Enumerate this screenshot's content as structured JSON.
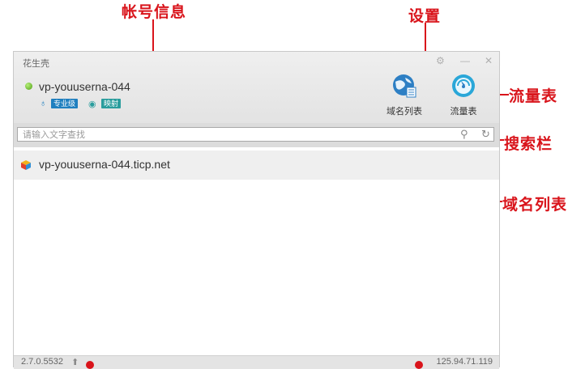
{
  "annotations": {
    "account_info": "帐号信息",
    "settings": "设置",
    "traffic_meter": "流量表",
    "search_bar": "搜索栏",
    "domain_list": "域名列表"
  },
  "window": {
    "title": "花生壳",
    "account": {
      "status": "online",
      "name": "vp-youuserna-044",
      "badges": [
        "专业级",
        "映射"
      ]
    },
    "toolbar": {
      "domain_list_label": "域名列表",
      "traffic_label": "流量表"
    },
    "search": {
      "placeholder": "请输入文字查找"
    },
    "domains": [
      {
        "name": "vp-youuserna-044.ticp.net"
      }
    ],
    "status": {
      "version": "2.7.0.5532",
      "ip": "125.94.71.119"
    }
  },
  "colors": {
    "annotation": "#d9141b",
    "online": "#4e9e12",
    "badge_blue": "#1f7fbf",
    "badge_teal": "#2a9d9d"
  }
}
